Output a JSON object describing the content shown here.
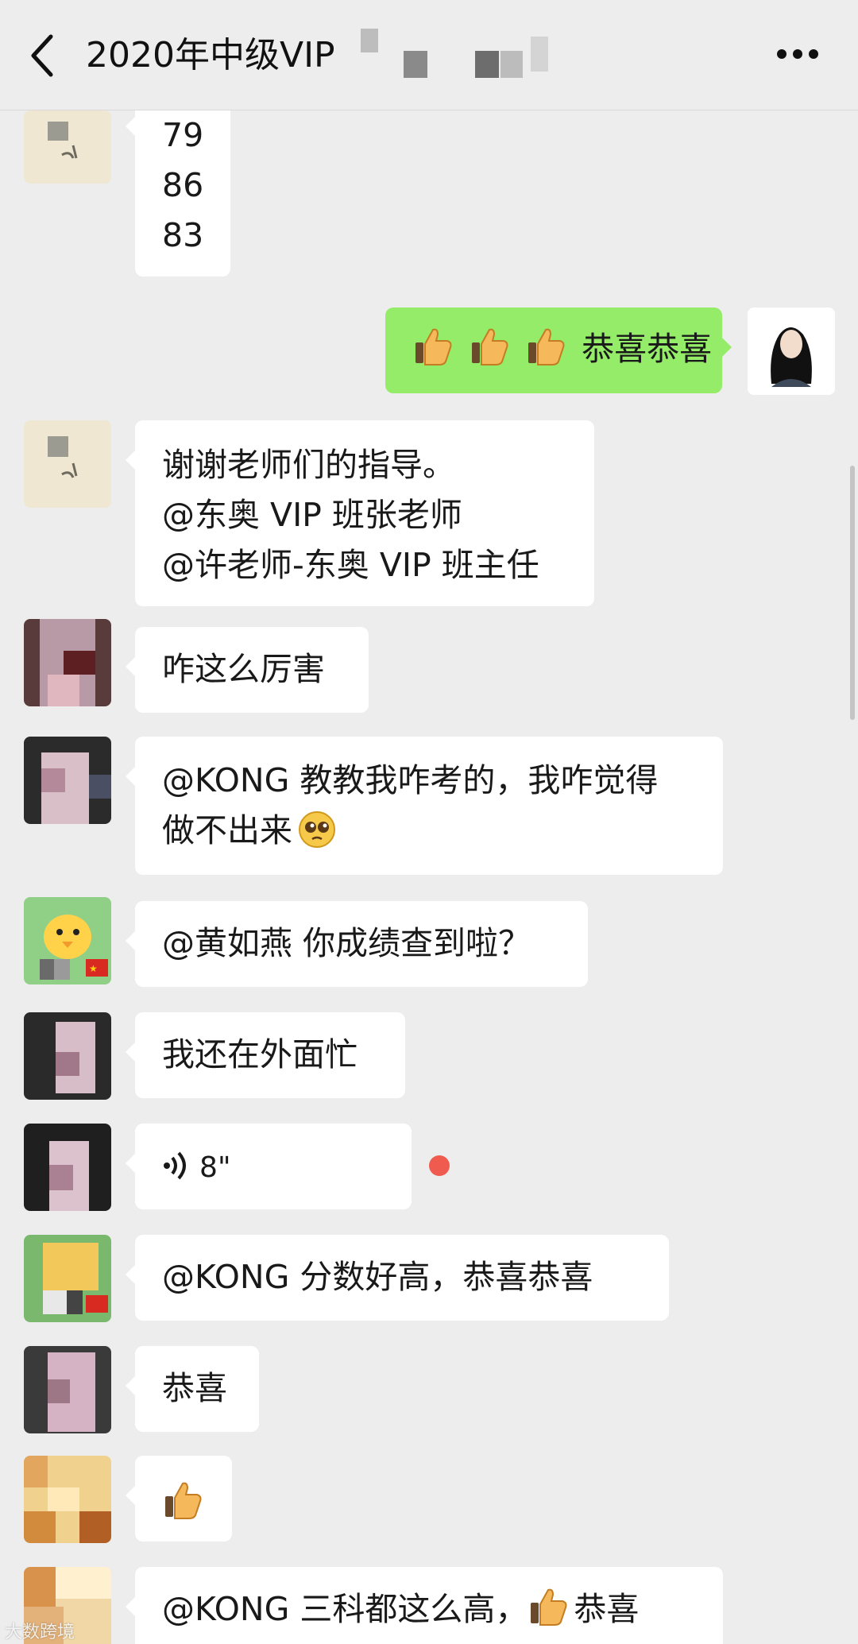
{
  "header": {
    "title": "2020年中级VIP",
    "back_icon": "chevron-left-icon",
    "more_icon": "more-dots-icon"
  },
  "messages": [
    {
      "side": "left",
      "lines": [
        "79",
        "86",
        "83"
      ]
    },
    {
      "side": "right",
      "lines": [
        "恭喜恭喜"
      ],
      "emoji": "thumbs-up x3"
    },
    {
      "side": "left",
      "lines": [
        "谢谢老师们的指导。",
        "@东奥 VIP 班张老师",
        "@许老师-东奥 VIP 班主任"
      ]
    },
    {
      "side": "left",
      "lines": [
        "咋这么厉害"
      ]
    },
    {
      "side": "left",
      "lines": [
        "@KONG  教教我咋考的，我咋觉得",
        "做不出来"
      ],
      "emoji": "pleading-face"
    },
    {
      "side": "left",
      "lines": [
        "@黄如燕  你成绩查到啦？"
      ]
    },
    {
      "side": "left",
      "lines": [
        "我还在外面忙"
      ]
    },
    {
      "side": "left",
      "type": "voice",
      "duration": "8\""
    },
    {
      "side": "left",
      "lines": [
        "@KONG  分数好高，恭喜恭喜"
      ]
    },
    {
      "side": "left",
      "lines": [
        "恭喜"
      ]
    },
    {
      "side": "left",
      "emoji": "thumbs-up"
    },
    {
      "side": "left",
      "lines": [
        "@KONG  三科都这么高，",
        "恭喜"
      ],
      "emoji": "thumbs-up"
    }
  ],
  "watermark": "大数跨境",
  "colors": {
    "background": "#ededed",
    "bubble_self": "#95ec69",
    "bubble_other": "#ffffff",
    "unread": "#f05b50"
  }
}
